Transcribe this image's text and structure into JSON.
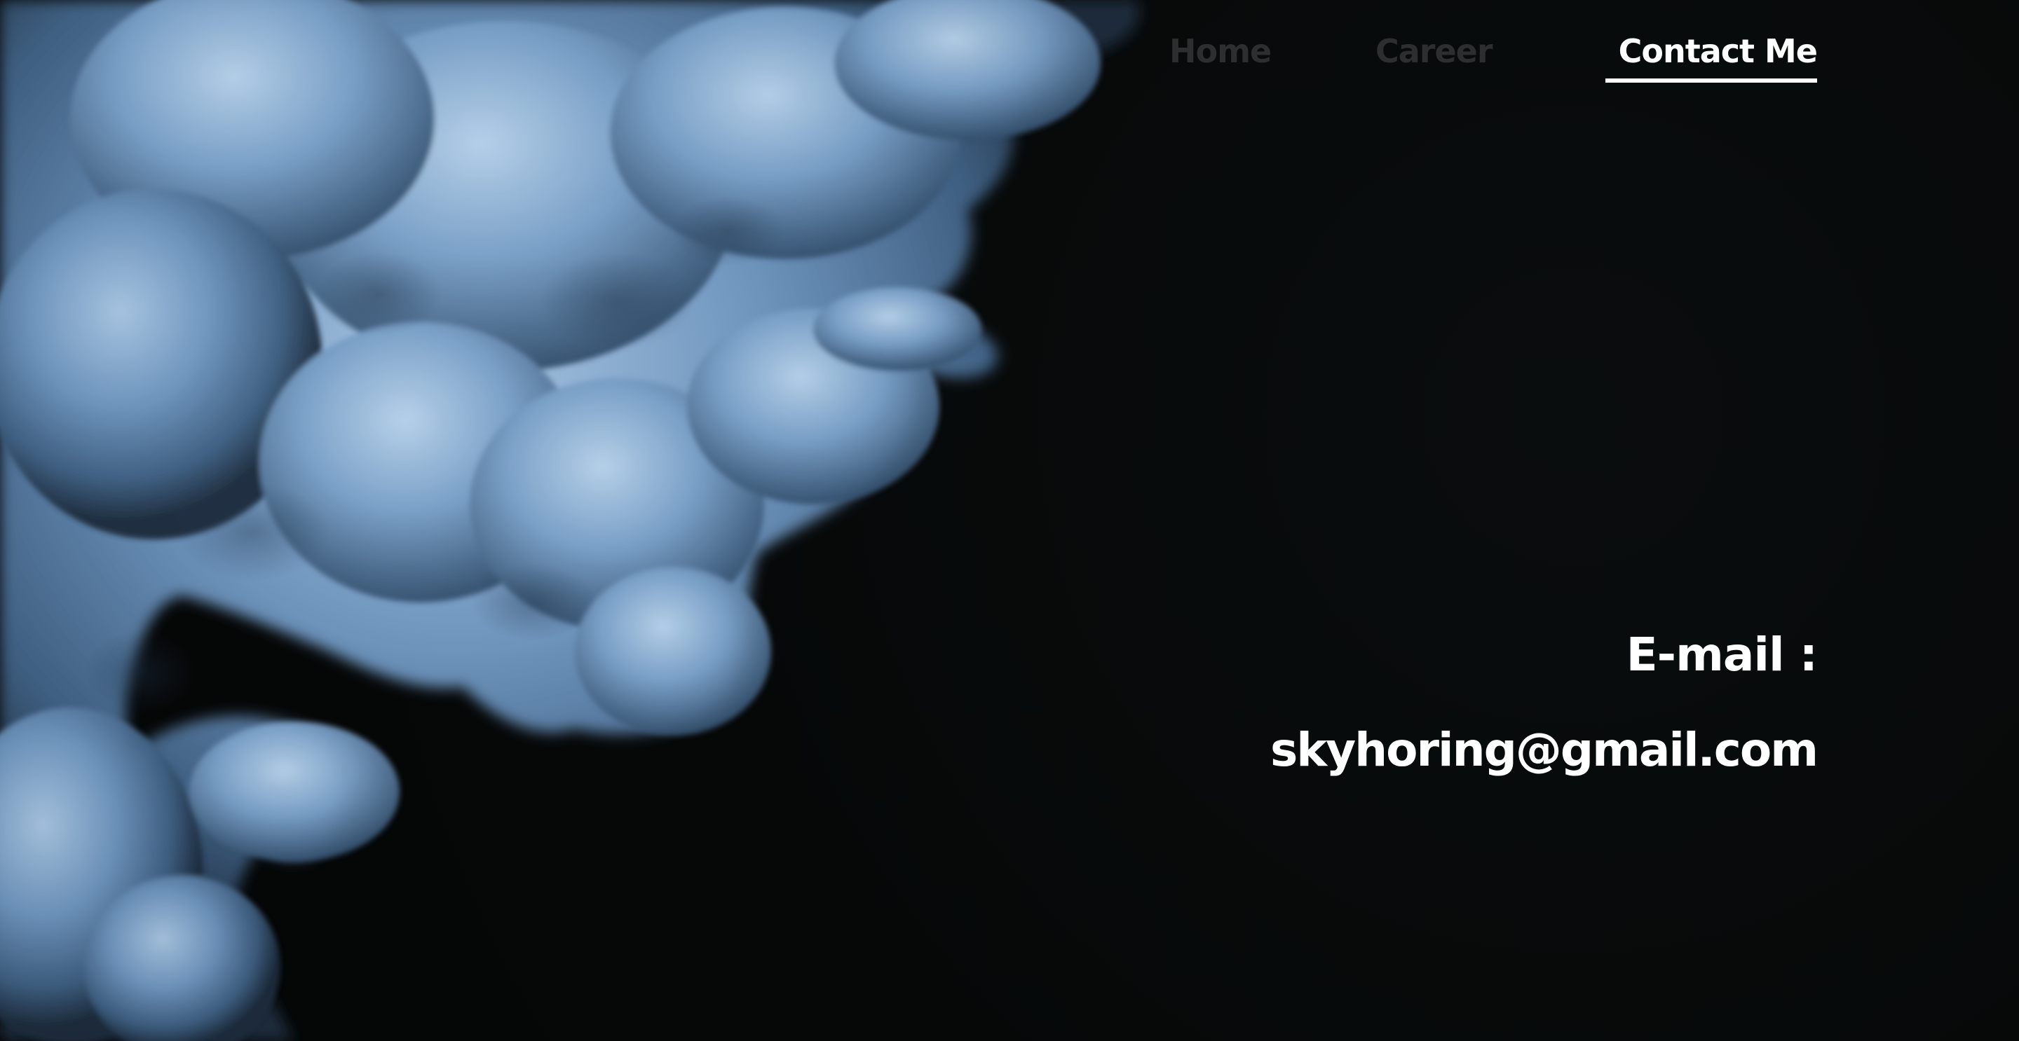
{
  "nav": {
    "items": [
      {
        "label": "Home",
        "active": false
      },
      {
        "label": "Career",
        "active": false
      },
      {
        "label": "Contact Me",
        "active": true
      }
    ]
  },
  "contact": {
    "email_label": "E-mail :",
    "email_value": "skyhoring@gmail.com"
  },
  "colors": {
    "background": "#050707",
    "smoke": "#6f95bd",
    "text_active": "#ffffff",
    "text_inactive": "#2c2e2f"
  }
}
